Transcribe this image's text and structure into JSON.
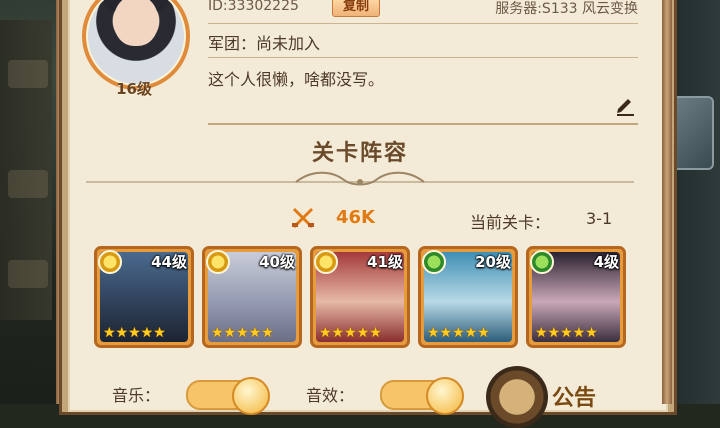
{
  "player": {
    "id_text": "ID:33302225",
    "copy_label": "复制",
    "server_text": "服务器:S133 风云变换",
    "level_text": "16级",
    "legion_text": "军团：尚未加入",
    "bio_text": "这个人很懒，啥都没写。"
  },
  "lineup": {
    "title": "关卡阵容",
    "power": "46K",
    "stage_label": "当前关卡：",
    "stage_value": "3-1",
    "heroes": [
      {
        "level": "44级",
        "badge": "gold",
        "stars": "★★★★★",
        "art": "dark-armored-warrior"
      },
      {
        "level": "40级",
        "badge": "gold",
        "stars": "★★★★★",
        "art": "silver-haired-elder"
      },
      {
        "level": "41级",
        "badge": "gold",
        "stars": "★★★★★",
        "art": "red-haired-girl"
      },
      {
        "level": "20级",
        "badge": "green",
        "stars": "★★★★★",
        "art": "blue-haired-girl"
      },
      {
        "level": "4级",
        "badge": "green",
        "stars": "★★★★★",
        "art": "dark-haired-lady"
      }
    ]
  },
  "settings": {
    "music_label": "音乐：",
    "sound_label": "音效：",
    "notice_label": "公告"
  },
  "colors": {
    "panel": "#f3ebd8",
    "frame": "#c3a67a",
    "accent_orange": "#e07a15",
    "text_brown": "#4d3a26"
  },
  "icons": {
    "edit": "pencil-icon",
    "power": "crossed-swords-icon",
    "notice": "megaphone-icon"
  }
}
